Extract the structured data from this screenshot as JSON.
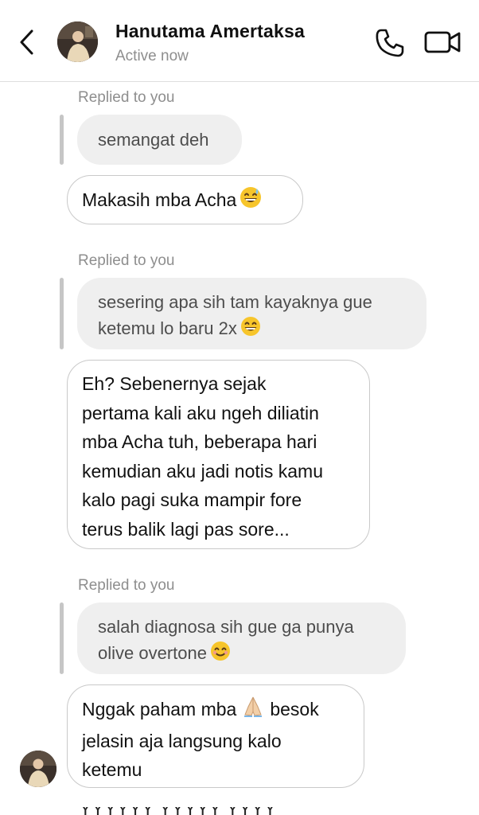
{
  "header": {
    "contact_name": "Hanutama Amertaksa",
    "status": "Active now"
  },
  "thread": {
    "replied_label": "Replied to you",
    "m1_quote": "semangat deh",
    "m1_reply": "Makasih mba Acha",
    "m2_quote_line1": "sesering apa sih tam kayaknya gue",
    "m2_quote_line2": "ketemu lo baru 2x",
    "m2_reply_l1": "Eh? Sebenernya sejak",
    "m2_reply_l2": "pertama kali aku ngeh diliatin",
    "m2_reply_l3": "mba Acha tuh, beberapa hari",
    "m2_reply_l4": "kemudian aku jadi notis kamu",
    "m2_reply_l5": "kalo pagi suka mampir fore",
    "m2_reply_l6": "terus balik lagi pas sore...",
    "m3_quote_line1": "salah diagnosa sih gue ga punya",
    "m3_quote_line2": "olive overtone",
    "m3_reply_l1a": "Nggak paham mba",
    "m3_reply_l1b": "besok",
    "m3_reply_l2": "jelasin aja langsung kalo",
    "m3_reply_l3": "ketemu",
    "partial_next": "YYYYYY YYYYY YYYY"
  },
  "icons": {
    "back": "chevron-left-icon",
    "call": "phone-icon",
    "video": "video-camera-icon",
    "emoji_sweat": "grinning-sweat-emoji",
    "emoji_grin": "grinning-emoji",
    "emoji_pray": "folded-hands-emoji",
    "emoji_smile": "smiling-blush-emoji"
  }
}
